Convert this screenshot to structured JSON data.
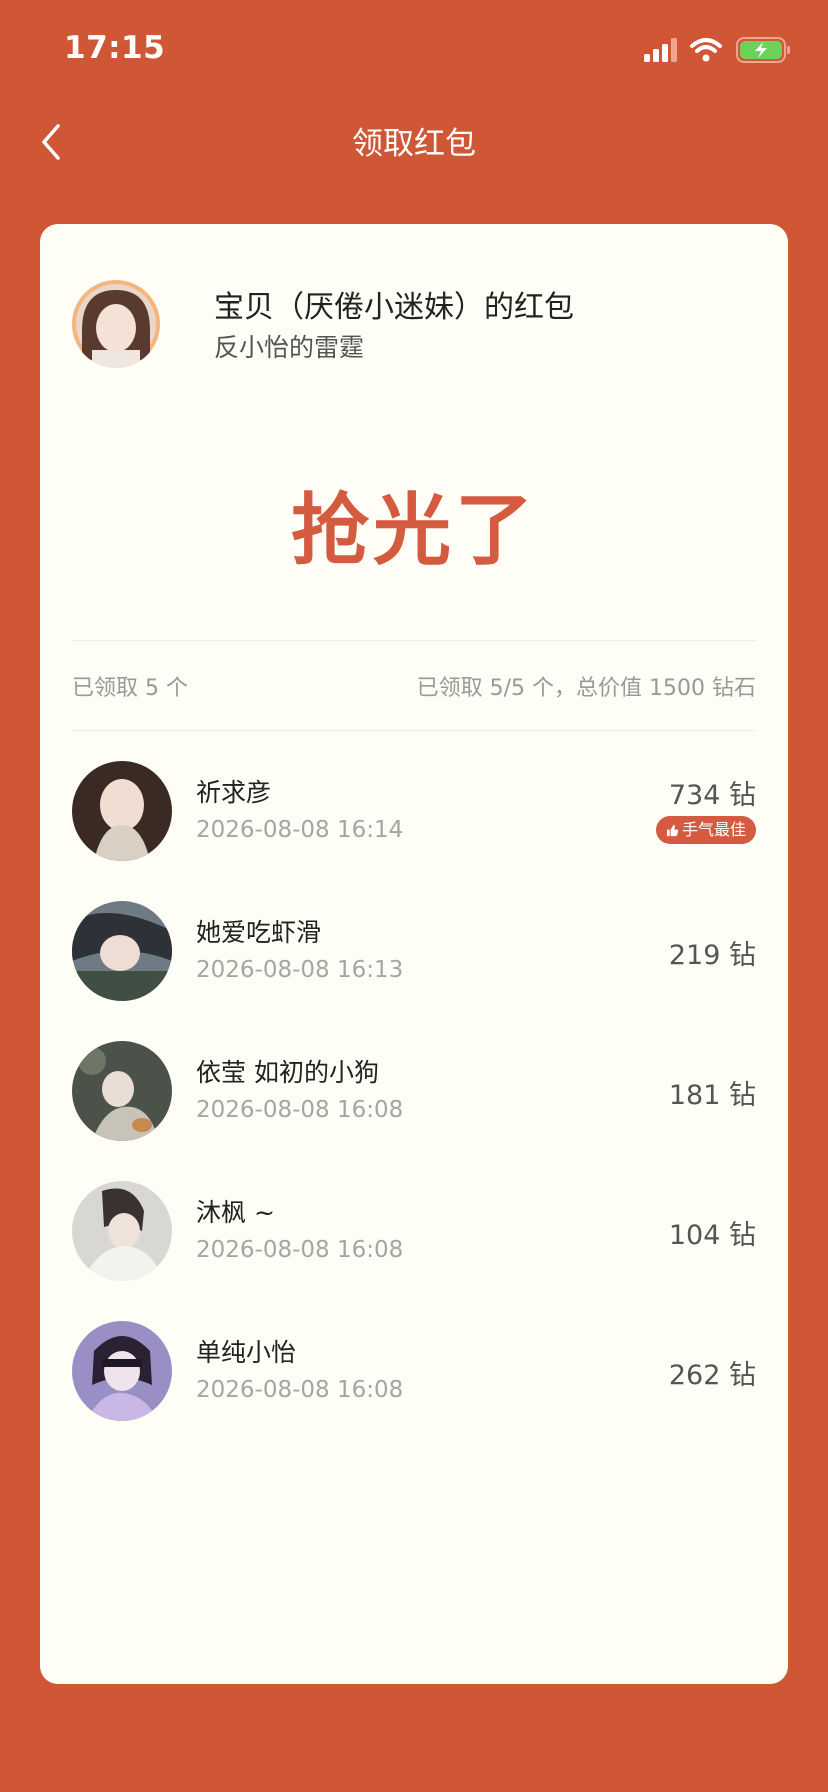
{
  "status_bar": {
    "time": "17:15"
  },
  "nav": {
    "title": "领取红包"
  },
  "sender": {
    "name": "宝贝（厌倦小迷妹）的红包",
    "subtitle": "反小怡的雷霆"
  },
  "status_text": "抢光了",
  "summary": {
    "left": "已领取 5 个",
    "right": "已领取 5/5 个，总价值 1500 钻石"
  },
  "recipients": [
    {
      "name": "祈求彦",
      "time": "2026-08-08 16:14",
      "amount": "734 钻",
      "badge": "手气最佳"
    },
    {
      "name": "她爱吃虾滑",
      "time": "2026-08-08 16:13",
      "amount": "219 钻"
    },
    {
      "name": "依莹 如初的小狗",
      "time": "2026-08-08 16:08",
      "amount": "181 钻"
    },
    {
      "name": "沐枫 ~",
      "time": "2026-08-08 16:08",
      "amount": "104 钻"
    },
    {
      "name": "单纯小怡",
      "time": "2026-08-08 16:08",
      "amount": "262 钻"
    }
  ],
  "colors": {
    "background": "#CF5736",
    "card": "#FEFDF6",
    "accent": "#D45A40",
    "battery": "#6CD35A"
  }
}
